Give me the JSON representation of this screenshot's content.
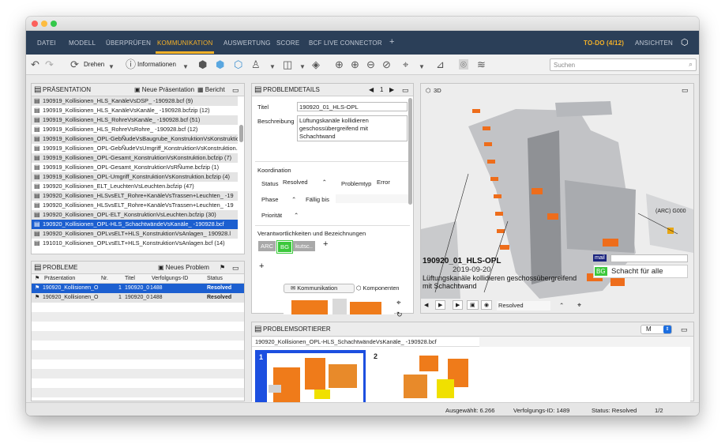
{
  "menu": {
    "items": [
      "DATEI",
      "MODELL",
      "ÜBERPRÜFEN",
      "KOMMUNIKATION",
      "AUSWERTUNG",
      "SCORE",
      "BCF LIVE CONNECTOR",
      "+"
    ],
    "todo": "TO-DO (4/12)",
    "views": "ANSICHTEN"
  },
  "toolbar": {
    "rotate": "Drehen",
    "info": "Informationen",
    "search_placeholder": "Suchen"
  },
  "presentation": {
    "title": "PRÄSENTATION",
    "new_label": "Neue Präsentation",
    "report_label": "Bericht",
    "items": [
      "190919_Kollisionen_HLS_KanäleVsDSP_          -190928.bcf (9)",
      "190919_Kollisionen_HLS_KanäleVsKanäle_         -190928.bcfzip (12)",
      "190919_Kollisionen_HLS_RohreVsKanäle_          -190928.bcf (51)",
      "190919_Kollisionen_HLS_RohreVsRohre_          -190928.bcf (12)",
      "190919_Kollisionen_OPL-GebÑudeVsBaugrube_KonstruktionVsKonstruktion.",
      "190919_Kollisionen_OPL-GebÑudeVsUmgriff_KonstruktionVsKonstruktion.bc",
      "190919_Kollisionen_OPL-Gesamt_KonstruktionVsKonstruktion.bcfzip (7)",
      "190919_Kollisionen_OPL-Gesamt_KonstruktionVsRÑume.bcfzip (1)",
      "190919_Kollisionen_OPL-Umgriff_KonstruktionVsKonstruktion.bcfzip (4)",
      "190920_Kollisionen_ELT_LeuchtenVsLeuchten.bcfzip (47)",
      "190920_Kollisionen_HLSvsELT_Rohre+KanäleVsTrassen+Leuchten_       -19",
      "190920_Kollisionen_HLSvsELT_Rohre+KanäleVsTrassen+Leuchten_       -19",
      "190920_Kollisionen_OPL-ELT_KonstruktionVsLeuchten.bcfzip (30)",
      "190920_Kollisionen_OPL-HLS_SchachtwändeVsKanäle_           -190928.bcf",
      "190920_Kollisionen_OPLvsELT+HLS_KonstruktionVsAnlagen_            190928.l",
      "191010_Kollisionen_OPLvsELT+HLS_KonstruktionVsAnlagen.bcf (14)"
    ],
    "selected_index": 13
  },
  "problems": {
    "title": "PROBLEME",
    "new_label": "Neues Problem",
    "columns": [
      "Präsentation",
      "Nr.",
      "Titel",
      "Verfolgungs-ID",
      "Status"
    ],
    "rows": [
      {
        "pres": "190920_Kollisionen_O",
        "nr": "1",
        "title": "190920_0",
        "track": "1488",
        "status": "Resolved"
      },
      {
        "pres": "190920_Kollisionen_O",
        "nr": "1",
        "title": "190920_0",
        "track": "1488",
        "status": "Resolved"
      }
    ]
  },
  "details": {
    "title": "PROBLEMDETAILS",
    "page": "1",
    "title_label": "Titel",
    "title_value": "190920_01_HLS-OPL",
    "desc_label": "Beschreibung",
    "desc_value": "Lüftungskanäle kollidieren geschossübergreifend mit Schachtwand",
    "coord_label": "Koordination",
    "status_label": "Status",
    "status_value": "Resolved",
    "type_label": "Problemtyp",
    "type_value": "Error",
    "phase_label": "Phase",
    "due_label": "Fällig bis",
    "priority_label": "Priorität",
    "resp_label": "Verantwortlichkeiten und Bezeichnungen",
    "tags": [
      "ARC",
      "BG",
      "kutsc.."
    ],
    "comm_tab": "Kommunikation",
    "comp_tab": "Komponenten"
  },
  "viewer": {
    "label": "3D",
    "issue_title": "190920_01_HLS-OPL",
    "issue_date": "2019-09-20",
    "issue_desc": "Lüftungskanäle kollidieren geschossübergreifend mit Schachtwand",
    "arc_tag": "(ARC) G000",
    "mail_label": "mail",
    "bg_label": "BG",
    "bg_text": "Schacht für alle",
    "status_value": "Resolved"
  },
  "sorter": {
    "title": "PROBLEMSORTIERER",
    "size": "M",
    "group": "190920_Kollisionen_OPL-HLS_SchachtwändeVsKanäle_          -190928.bcf",
    "cards": [
      "1",
      "2"
    ]
  },
  "status": {
    "selected": "Ausgewählt: 6.266",
    "tracking": "Verfolgungs-ID: 1489",
    "status": "Status: Resolved",
    "page": "1/2"
  },
  "colors": {
    "menubar": "#2b3f58",
    "accent": "#f6b228",
    "selection": "#1c5fd0",
    "bg_tag": "#3cc83c"
  }
}
